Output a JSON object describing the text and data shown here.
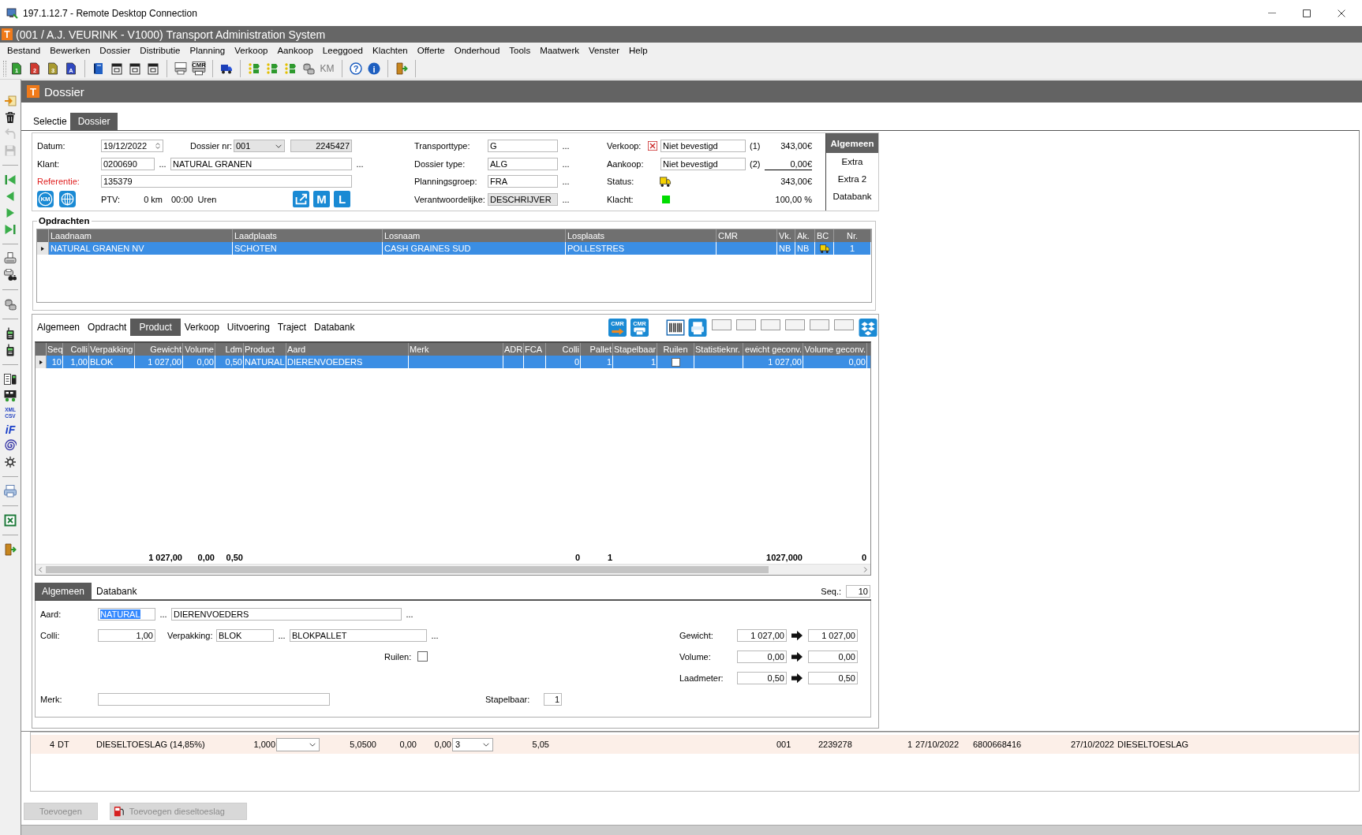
{
  "remote_window": {
    "title": "197.1.12.7 - Remote Desktop Connection"
  },
  "app_window": {
    "logo": "T",
    "title": "(001 / A.J. VEURINK - V1000) Transport Administration System"
  },
  "menu": [
    "Bestand",
    "Bewerken",
    "Dossier",
    "Distributie",
    "Planning",
    "Verkoop",
    "Aankoop",
    "Leeggoed",
    "Klachten",
    "Offerte",
    "Onderhoud",
    "Tools",
    "Maatwerk",
    "Venster",
    "Help"
  ],
  "toolbar": [
    {
      "items": [
        {
          "kind": "doc",
          "color": "#35a035",
          "label": "1"
        },
        {
          "kind": "doc",
          "color": "#d03a30",
          "label": "2"
        },
        {
          "kind": "doc",
          "color": "#a89a30",
          "label": "3"
        },
        {
          "kind": "doc",
          "color": "#3048c0",
          "label": "A"
        }
      ]
    },
    {
      "items": [
        {
          "kind": "book"
        },
        {
          "kind": "calendar"
        },
        {
          "kind": "calendar"
        },
        {
          "kind": "calendar"
        }
      ]
    },
    {
      "items": [
        {
          "kind": "printer"
        },
        {
          "kind": "printer",
          "label": "CMR"
        }
      ]
    },
    {
      "items": [
        {
          "kind": "truck"
        }
      ]
    },
    {
      "items": [
        {
          "kind": "route"
        },
        {
          "kind": "route"
        },
        {
          "kind": "route"
        },
        {
          "kind": "database"
        },
        {
          "kind": "text",
          "label": "KM"
        }
      ]
    },
    {
      "items": [
        {
          "kind": "help",
          "label": "?"
        },
        {
          "kind": "info",
          "label": "i"
        }
      ]
    },
    {
      "items": [
        {
          "kind": "exit"
        }
      ]
    }
  ],
  "side_toolbar": [
    {
      "items": [
        {
          "kind": "import",
          "disabled": false
        },
        {
          "kind": "trash",
          "disabled": false
        },
        {
          "kind": "undo",
          "disabled": true
        },
        {
          "kind": "save",
          "disabled": true
        }
      ]
    },
    {
      "items": [
        {
          "kind": "first",
          "disabled": false
        },
        {
          "kind": "prev",
          "disabled": false
        },
        {
          "kind": "next",
          "disabled": false
        },
        {
          "kind": "last",
          "disabled": false
        }
      ]
    },
    {
      "items": [
        {
          "kind": "print_doc",
          "disabled": false
        },
        {
          "kind": "print_search",
          "disabled": false
        }
      ]
    },
    {
      "items": [
        {
          "kind": "database",
          "disabled": false
        }
      ]
    },
    {
      "items": [
        {
          "kind": "phone",
          "disabled": false
        },
        {
          "kind": "phone",
          "disabled": false
        }
      ]
    },
    {
      "items": [
        {
          "kind": "doc_phone",
          "disabled": false
        },
        {
          "kind": "truck_grid",
          "disabled": false
        },
        {
          "kind": "xml",
          "label": "XML",
          "label2": "CSV",
          "disabled": false
        },
        {
          "kind": "if",
          "label": "iF",
          "disabled": false
        },
        {
          "kind": "spiral",
          "disabled": false
        },
        {
          "kind": "gear",
          "disabled": false
        }
      ]
    },
    {
      "items": [
        {
          "kind": "printer2",
          "disabled": false
        }
      ]
    },
    {
      "items": [
        {
          "kind": "excel",
          "disabled": false
        }
      ]
    },
    {
      "items": [
        {
          "kind": "exit",
          "disabled": false
        }
      ]
    }
  ],
  "document": {
    "logo": "T",
    "title": "Dossier",
    "tabs": [
      {
        "label": "Selectie",
        "selected": false
      },
      {
        "label": "Dossier",
        "selected": true
      }
    ]
  },
  "header": {
    "left": {
      "datum": {
        "label": "Datum:",
        "value": "19/12/2022"
      },
      "dossier_nr": {
        "label": "Dossier nr:",
        "value": "001",
        "number": "2245427"
      },
      "klant": {
        "label": "Klant:",
        "code": "0200690",
        "lookup": "...",
        "name": "NATURAL GRANEN",
        "name_lookup": "..."
      },
      "referentie": {
        "label": "Referentie:",
        "value": "135379",
        "required": true
      },
      "tools": [
        {
          "kind": "km",
          "label": "KM"
        },
        {
          "kind": "globe"
        }
      ],
      "ptv": {
        "label": "PTV:",
        "distance": "0 km",
        "time": "00:00",
        "unit": "Uren"
      },
      "actions": [
        {
          "kind": "share"
        },
        {
          "kind": "letter",
          "label": "M"
        },
        {
          "kind": "letter",
          "label": "L"
        }
      ]
    },
    "middle": [
      {
        "label": "Transporttype:",
        "value": "G",
        "readonly": false,
        "lookup": "..."
      },
      {
        "label": "Dossier type:",
        "value": "ALG",
        "readonly": false,
        "lookup": "..."
      },
      {
        "label": "Planningsgroep:",
        "value": "FRA",
        "readonly": false,
        "lookup": "..."
      },
      {
        "label": "Verantwoordelijke:",
        "value": "DESCHRIJVER",
        "readonly": true,
        "lookup": "..."
      }
    ],
    "right": [
      {
        "kind": "approval",
        "label": "Verkoop:",
        "flagged": true,
        "value": "Niet bevestigd",
        "index": "(1)",
        "amount": "343,00€",
        "total_rule": false
      },
      {
        "kind": "approval",
        "label": "Aankoop:",
        "flagged": false,
        "value": "Niet bevestigd",
        "index": "(2)",
        "amount": "0,00€",
        "total_rule": true
      },
      {
        "kind": "status",
        "label": "Status:",
        "amount": "343,00€"
      },
      {
        "kind": "indicator",
        "label": "Klacht:",
        "color": "#00dd00",
        "amount": "100,00 %"
      }
    ],
    "side_tabs": [
      {
        "label": "Algemeen",
        "selected": true
      },
      {
        "label": "Extra",
        "selected": false
      },
      {
        "label": "Extra 2",
        "selected": false
      },
      {
        "label": "Databank",
        "selected": false
      }
    ]
  },
  "orders": {
    "title": "Opdrachten",
    "columns": [
      "Laadnaam",
      "Laadplaats",
      "Losnaam",
      "Losplaats",
      "CMR",
      "Vk.",
      "Ak.",
      "BC",
      "Nr."
    ],
    "rows": [
      {
        "selected": true,
        "cells": [
          "NATURAL GRANEN NV",
          "SCHOTEN",
          "CASH GRAINES SUD",
          "POLLESTRES",
          {
            "kind": "blank"
          },
          "NB",
          "NB",
          {
            "kind": "status"
          },
          "1"
        ]
      }
    ]
  },
  "order_tabs": [
    {
      "label": "Algemeen",
      "selected": false
    },
    {
      "label": "Opdracht",
      "selected": false
    },
    {
      "label": "Product",
      "selected": true
    },
    {
      "label": "Verkoop",
      "selected": false
    },
    {
      "label": "Uitvoering",
      "selected": false
    },
    {
      "label": "Traject",
      "selected": false
    },
    {
      "label": "Databank",
      "selected": false
    }
  ],
  "order_tools": [
    {
      "kind": "cmr_send",
      "label": "CMR"
    },
    {
      "kind": "cmr_print",
      "label": "CMR"
    },
    {
      "kind": "barcode"
    },
    {
      "kind": "print_form"
    },
    {
      "kind": "blank"
    },
    {
      "kind": "blank"
    },
    {
      "kind": "blank"
    },
    {
      "kind": "blank"
    },
    {
      "kind": "blank"
    },
    {
      "kind": "blank"
    },
    {
      "kind": "diamonds"
    }
  ],
  "products": {
    "columns": [
      {
        "label": "Seq"
      },
      {
        "label": "Colli"
      },
      {
        "label": "Verpakking"
      },
      {
        "label": "Gewicht",
        "total": "1 027,00"
      },
      {
        "label": "Volume",
        "total": "0,00"
      },
      {
        "label": "Ldm",
        "total": "0,50"
      },
      {
        "label": "Product"
      },
      {
        "label": "Aard"
      },
      {
        "label": "Merk"
      },
      {
        "label": "ADR"
      },
      {
        "label": "FCA"
      },
      {
        "label": "Colli",
        "total": "0"
      },
      {
        "label": "Pallet",
        "total": "1"
      },
      {
        "label": "Stapelbaar"
      },
      {
        "label": "Ruilen"
      },
      {
        "label": "Statistieknr."
      },
      {
        "label": "ewicht geconv.",
        "total": "1027,000"
      },
      {
        "label": "Volume geconv.",
        "total": "0"
      }
    ],
    "rows": [
      {
        "selected": true,
        "cells": [
          "10",
          "1,00",
          "BLOK",
          "1 027,00",
          "0,00",
          "0,50",
          "NATURAL",
          "DIERENVOEDERS",
          {
            "kind": "blank"
          },
          {
            "kind": "blank"
          },
          {
            "kind": "blank"
          },
          "0",
          "1",
          "1",
          {
            "kind": "checkbox",
            "checked": false
          },
          {
            "kind": "blank"
          },
          "1 027,00",
          "0,00"
        ]
      }
    ]
  },
  "product_detail": {
    "tabs": [
      {
        "label": "Algemeen",
        "selected": true
      },
      {
        "label": "Databank",
        "selected": false
      }
    ],
    "seq": {
      "label": "Seq.:",
      "value": "10"
    },
    "aard": {
      "label": "Aard:",
      "code": "NATURAL",
      "code_selected": true,
      "lookup": "...",
      "name": "DIERENVOEDERS",
      "name_lookup": "..."
    },
    "colli": {
      "label": "Colli:",
      "value": "1,00"
    },
    "verpakking": {
      "label": "Verpakking:",
      "code": "BLOK",
      "lookup": "...",
      "name": "BLOKPALLET",
      "name_lookup": "..."
    },
    "ruilen": {
      "label": "Ruilen:",
      "checked": false
    },
    "merk": {
      "label": "Merk:"
    },
    "stapelbaar": {
      "label": "Stapelbaar:",
      "value": "1"
    },
    "measures": [
      {
        "label": "Gewicht:",
        "value": "1 027,00",
        "converted": "1 027,00"
      },
      {
        "label": "Volume:",
        "value": "0,00",
        "converted": "0,00"
      },
      {
        "label": "Laadmeter:",
        "value": "0,50",
        "converted": "0,50"
      }
    ]
  },
  "charges": {
    "rows": [
      {
        "cells": [
          "4",
          "DT",
          "DIESELTOESLAG (14,85%)",
          "1,000",
          {
            "kind": "dropdown"
          },
          "5,0500",
          "0,00",
          "0,00",
          {
            "kind": "dropdown",
            "value": "3"
          },
          "5,05",
          {
            "kind": "blank"
          },
          "001",
          "2239278",
          "1",
          "27/10/2022",
          "6800668416",
          "27/10/2022",
          "DIESELTOESLAG"
        ]
      }
    ]
  },
  "actions": [
    {
      "kind": "plain",
      "label": "Toevoegen",
      "disabled": true
    },
    {
      "kind": "fuel",
      "label": "Toevoegen dieseltoeslag",
      "disabled": true
    }
  ]
}
